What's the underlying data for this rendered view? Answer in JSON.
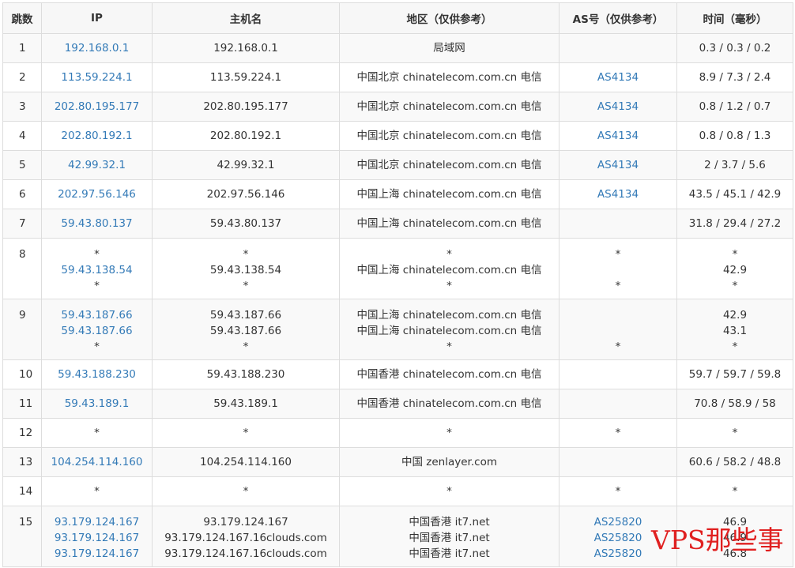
{
  "headers": {
    "hop": "跳数",
    "ip": "IP",
    "host": "主机名",
    "region": "地区（仅供参考）",
    "as": "AS号（仅供参考）",
    "time": "时间（毫秒）"
  },
  "rows": [
    {
      "hop": "1",
      "ip": [
        "192.168.0.1"
      ],
      "host": [
        "192.168.0.1"
      ],
      "region": [
        "局域网"
      ],
      "as": [
        ""
      ],
      "time": [
        "0.3 / 0.3 / 0.2"
      ]
    },
    {
      "hop": "2",
      "ip": [
        "113.59.224.1"
      ],
      "host": [
        "113.59.224.1"
      ],
      "region": [
        "中国北京 chinatelecom.com.cn 电信"
      ],
      "as": [
        "AS4134"
      ],
      "time": [
        "8.9 / 7.3 / 2.4"
      ]
    },
    {
      "hop": "3",
      "ip": [
        "202.80.195.177"
      ],
      "host": [
        "202.80.195.177"
      ],
      "region": [
        "中国北京 chinatelecom.com.cn 电信"
      ],
      "as": [
        "AS4134"
      ],
      "time": [
        "0.8 / 1.2 / 0.7"
      ]
    },
    {
      "hop": "4",
      "ip": [
        "202.80.192.1"
      ],
      "host": [
        "202.80.192.1"
      ],
      "region": [
        "中国北京 chinatelecom.com.cn 电信"
      ],
      "as": [
        "AS4134"
      ],
      "time": [
        "0.8 / 0.8 / 1.3"
      ]
    },
    {
      "hop": "5",
      "ip": [
        "42.99.32.1"
      ],
      "host": [
        "42.99.32.1"
      ],
      "region": [
        "中国北京 chinatelecom.com.cn 电信"
      ],
      "as": [
        "AS4134"
      ],
      "time": [
        "2 / 3.7 / 5.6"
      ]
    },
    {
      "hop": "6",
      "ip": [
        "202.97.56.146"
      ],
      "host": [
        "202.97.56.146"
      ],
      "region": [
        "中国上海 chinatelecom.com.cn 电信"
      ],
      "as": [
        "AS4134"
      ],
      "time": [
        "43.5 / 45.1 / 42.9"
      ]
    },
    {
      "hop": "7",
      "ip": [
        "59.43.80.137"
      ],
      "host": [
        "59.43.80.137"
      ],
      "region": [
        "中国上海 chinatelecom.com.cn 电信"
      ],
      "as": [
        ""
      ],
      "time": [
        "31.8 / 29.4 / 27.2"
      ]
    },
    {
      "hop": "8",
      "ip": [
        "*",
        "59.43.138.54",
        "*"
      ],
      "host": [
        "*",
        "59.43.138.54",
        "*"
      ],
      "region": [
        "*",
        "中国上海 chinatelecom.com.cn 电信",
        "*"
      ],
      "as": [
        "*",
        "",
        "*"
      ],
      "time": [
        "*",
        "42.9",
        "*"
      ]
    },
    {
      "hop": "9",
      "ip": [
        "59.43.187.66",
        "59.43.187.66",
        "*"
      ],
      "host": [
        "59.43.187.66",
        "59.43.187.66",
        "*"
      ],
      "region": [
        "中国上海 chinatelecom.com.cn 电信",
        "中国上海 chinatelecom.com.cn 电信",
        "*"
      ],
      "as": [
        "",
        "",
        "*"
      ],
      "time": [
        "42.9",
        "43.1",
        "*"
      ]
    },
    {
      "hop": "10",
      "ip": [
        "59.43.188.230"
      ],
      "host": [
        "59.43.188.230"
      ],
      "region": [
        "中国香港 chinatelecom.com.cn 电信"
      ],
      "as": [
        ""
      ],
      "time": [
        "59.7 / 59.7 / 59.8"
      ]
    },
    {
      "hop": "11",
      "ip": [
        "59.43.189.1"
      ],
      "host": [
        "59.43.189.1"
      ],
      "region": [
        "中国香港 chinatelecom.com.cn 电信"
      ],
      "as": [
        ""
      ],
      "time": [
        "70.8 / 58.9 / 58"
      ]
    },
    {
      "hop": "12",
      "ip": [
        "*"
      ],
      "host": [
        "*"
      ],
      "region": [
        "*"
      ],
      "as": [
        "*"
      ],
      "time": [
        "*"
      ]
    },
    {
      "hop": "13",
      "ip": [
        "104.254.114.160"
      ],
      "host": [
        "104.254.114.160"
      ],
      "region": [
        "中国 zenlayer.com"
      ],
      "as": [
        ""
      ],
      "time": [
        "60.6 / 58.2 / 48.8"
      ]
    },
    {
      "hop": "14",
      "ip": [
        "*"
      ],
      "host": [
        "*"
      ],
      "region": [
        "*"
      ],
      "as": [
        "*"
      ],
      "time": [
        "*"
      ]
    },
    {
      "hop": "15",
      "ip": [
        "93.179.124.167",
        "93.179.124.167",
        "93.179.124.167"
      ],
      "host": [
        "93.179.124.167",
        "93.179.124.167.16clouds.com",
        "93.179.124.167.16clouds.com"
      ],
      "region": [
        "中国香港 it7.net",
        "中国香港 it7.net",
        "中国香港 it7.net"
      ],
      "as": [
        "AS25820",
        "AS25820",
        "AS25820"
      ],
      "time": [
        "46.9",
        "46.9",
        "46.8"
      ]
    }
  ],
  "watermark": "VPS那些事",
  "colors": {
    "link": "#337ab7",
    "watermark": "#e02020",
    "border": "#dddddd",
    "header_bg": "#f7f7f7"
  }
}
